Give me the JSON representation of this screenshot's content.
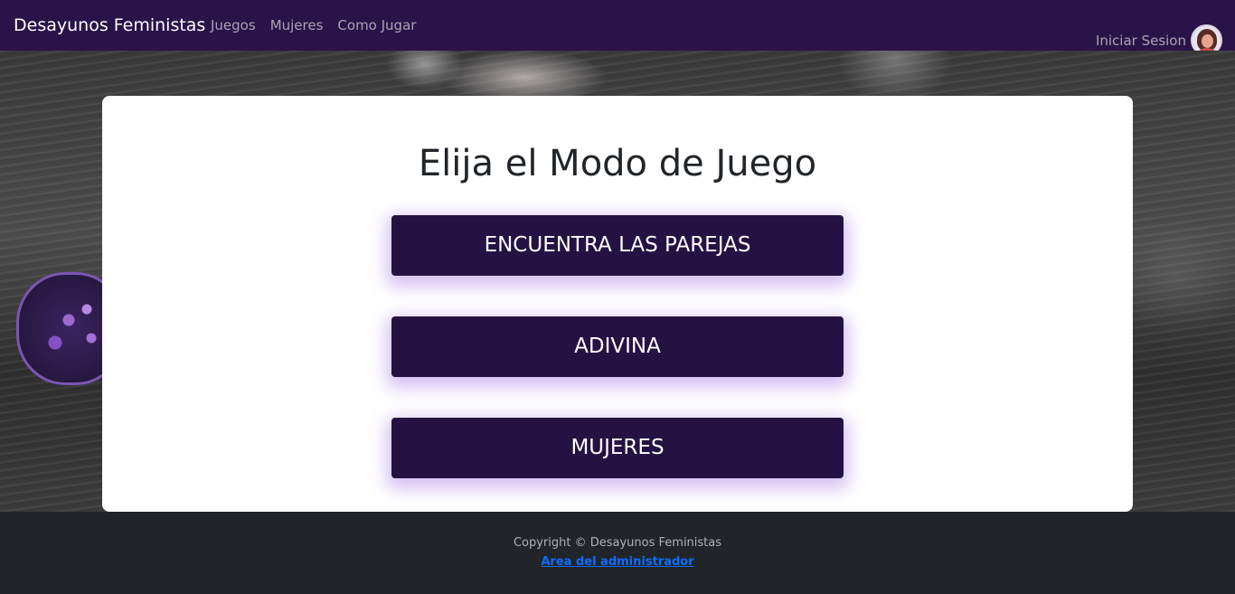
{
  "navbar": {
    "brand": "Desayunos Feministas",
    "links": [
      "Juegos",
      "Mujeres",
      "Como Jugar"
    ],
    "login_label": "Iniciar Sesion",
    "color": "#2a1348"
  },
  "main": {
    "title": "Elija el Modo de Juego",
    "buttons": [
      "ENCUENTRA LAS PAREJAS",
      "ADIVINA",
      "MUJERES"
    ],
    "button_color": "#251242"
  },
  "footer": {
    "copyright": "Copyright © Desayunos Feministas",
    "admin_link": "Area del administrador"
  }
}
